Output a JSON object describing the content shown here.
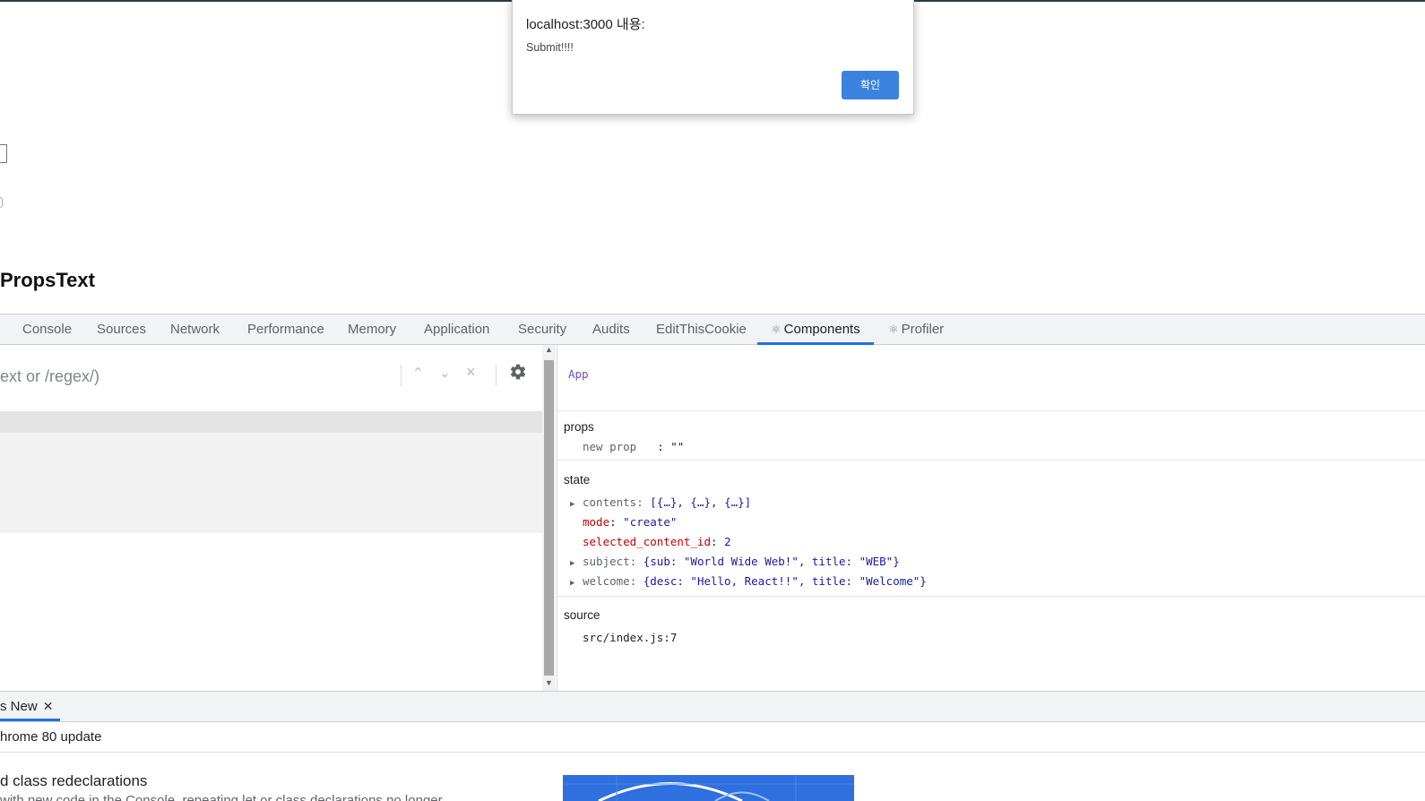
{
  "page": {
    "heading": "PropsText"
  },
  "alert": {
    "title": "localhost:3000 내용:",
    "message": "Submit!!!!",
    "ok_label": "확인"
  },
  "devtools": {
    "tabs": [
      {
        "label": "Console"
      },
      {
        "label": "Sources"
      },
      {
        "label": "Network"
      },
      {
        "label": "Performance"
      },
      {
        "label": "Memory"
      },
      {
        "label": "Application"
      },
      {
        "label": "Security"
      },
      {
        "label": "Audits"
      },
      {
        "label": "EditThisCookie"
      },
      {
        "label": "Components",
        "icon": "⚛"
      },
      {
        "label": "Profiler",
        "icon": "⚛"
      }
    ],
    "active_tab": "Components",
    "search": {
      "text": "ext or /regex/)"
    },
    "component": {
      "name": "App",
      "props_label": "props",
      "new_prop": "new prop",
      "new_prop_value": ": \"\"",
      "state_label": "state",
      "state": [
        {
          "key": "contents",
          "value": "[{…}, {…}, {…}]",
          "expandable": true
        },
        {
          "key": "mode",
          "value": "\"create\"",
          "expandable": false
        },
        {
          "key": "selected_content_id",
          "value": "2",
          "expandable": false
        },
        {
          "key": "subject",
          "value": "{sub: \"World Wide Web!\", title: \"WEB\"}",
          "expandable": true
        },
        {
          "key": "welcome",
          "value": "{desc: \"Hello, React!!\", title: \"Welcome\"}",
          "expandable": true
        }
      ],
      "source_label": "source",
      "source": "src/index.js:7"
    },
    "drawer": {
      "tab_label": "s New",
      "subtitle": "hrome 80 update",
      "heading": "d class redeclarations",
      "body": "with new code in the Console, repeating let or class declarations no longer"
    }
  }
}
